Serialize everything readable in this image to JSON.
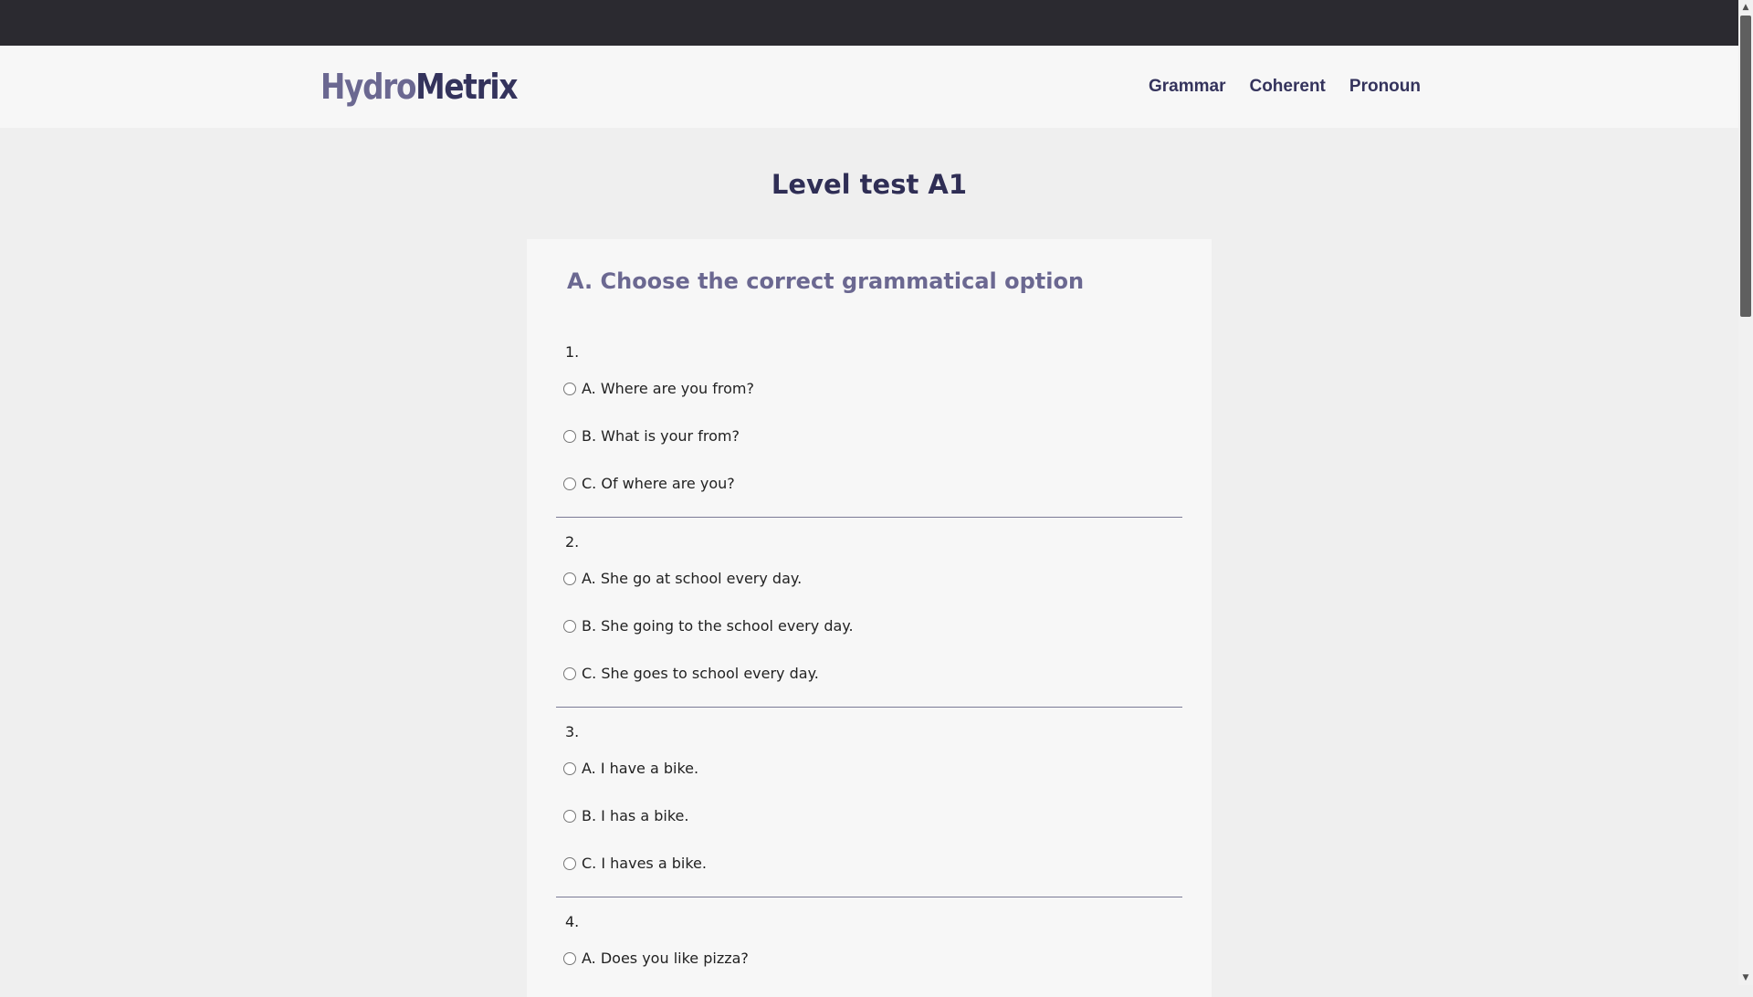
{
  "brand": {
    "part1": "Hydro",
    "part2": "Metrix",
    "colors": {
      "light": "#6b6891",
      "dark": "#34335c"
    }
  },
  "nav": {
    "items": [
      {
        "label": "Grammar"
      },
      {
        "label": "Coherent"
      },
      {
        "label": "Pronoun"
      }
    ]
  },
  "page": {
    "title": "Level test A1"
  },
  "section": {
    "title": "A. Choose the correct grammatical option"
  },
  "questions": [
    {
      "number": "1.",
      "options": [
        {
          "label": "A. Where are you from?"
        },
        {
          "label": "B. What is your from?"
        },
        {
          "label": "C. Of where are you?"
        }
      ]
    },
    {
      "number": "2.",
      "options": [
        {
          "label": "A. She go at school every day."
        },
        {
          "label": "B. She going to the school every day."
        },
        {
          "label": "C. She goes to school every day."
        }
      ]
    },
    {
      "number": "3.",
      "options": [
        {
          "label": "A. I have a bike."
        },
        {
          "label": "B. I has a bike."
        },
        {
          "label": "C. I haves a bike."
        }
      ]
    },
    {
      "number": "4.",
      "options": [
        {
          "label": "A. Does you like pizza?"
        }
      ]
    }
  ],
  "icons": {
    "scroll_up": "scroll-up-arrow-icon",
    "scroll_down": "scroll-down-arrow-icon"
  }
}
